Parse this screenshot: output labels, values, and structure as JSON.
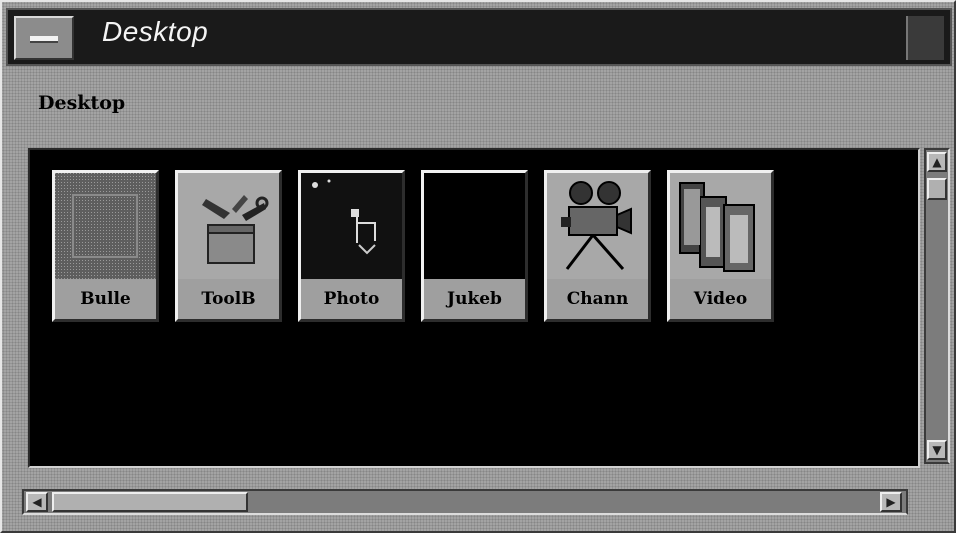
{
  "window": {
    "title": "Desktop"
  },
  "header": {
    "label": "Desktop"
  },
  "icons": [
    {
      "label": "Bulle",
      "icon": "bulletin-board-icon"
    },
    {
      "label": "ToolB",
      "icon": "toolbox-icon"
    },
    {
      "label": "Photo",
      "icon": "photo-icon"
    },
    {
      "label": "Jukeb",
      "icon": "jukebox-icon"
    },
    {
      "label": "Chann",
      "icon": "movie-camera-icon"
    },
    {
      "label": "Video",
      "icon": "film-strip-icon"
    }
  ],
  "scrollbars": {
    "vertical": {
      "up_arrow": "▲",
      "down_arrow": "▼"
    },
    "horizontal": {
      "left_arrow": "◀",
      "right_arrow": "▶"
    }
  }
}
